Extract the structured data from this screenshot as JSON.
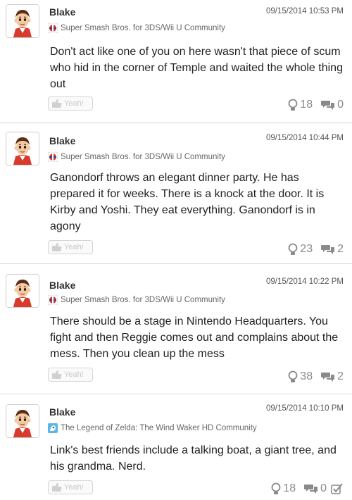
{
  "posts": [
    {
      "username": "Blake",
      "timestamp": "09/15/2014 10:53 PM",
      "community": "Super Smash Bros. for 3DS/Wii U Community",
      "community_icon": "smash-icon",
      "body": "Don't act like one of you on here wasn't that piece of scum who hid in the corner of Temple and waited the whole thing out",
      "yeah_label": "Yeah!",
      "yeahs": "18",
      "comments": "0"
    },
    {
      "username": "Blake",
      "timestamp": "09/15/2014 10:44 PM",
      "community": "Super Smash Bros. for 3DS/Wii U Community",
      "community_icon": "smash-icon",
      "body": "Ganondorf throws an elegant dinner party. He has prepared it for weeks. There is a knock at the door. It is Kirby and Yoshi. They eat everything. Ganondorf is in agony",
      "yeah_label": "Yeah!",
      "yeahs": "23",
      "comments": "2"
    },
    {
      "username": "Blake",
      "timestamp": "09/15/2014 10:22 PM",
      "community": "Super Smash Bros. for 3DS/Wii U Community",
      "community_icon": "smash-icon",
      "body": "There should be a stage in Nintendo Headquarters. You fight and then Reggie comes out and complains about the mess. Then you clean up the mess",
      "yeah_label": "Yeah!",
      "yeahs": "38",
      "comments": "2"
    },
    {
      "username": "Blake",
      "timestamp": "09/15/2014 10:10 PM",
      "community": "The Legend of Zelda: The Wind Waker HD Community",
      "community_icon": "zelda-icon",
      "body": "Link's best friends include a talking boat, a giant tree, and his grandma. Nerd.",
      "yeah_label": "Yeah!",
      "yeahs": "18",
      "comments": "0"
    }
  ]
}
